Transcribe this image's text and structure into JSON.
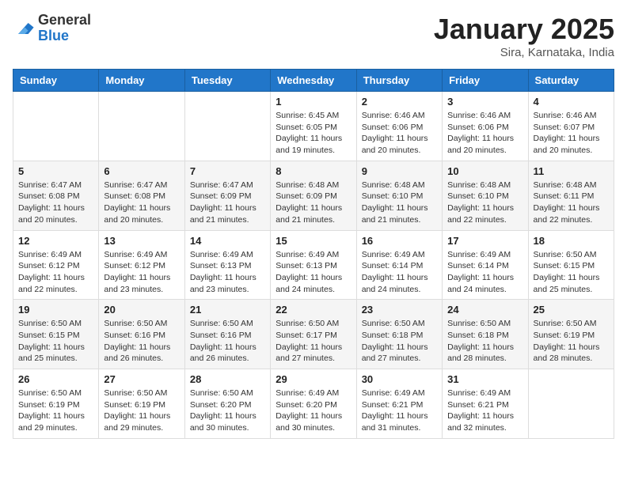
{
  "header": {
    "logo_general": "General",
    "logo_blue": "Blue",
    "title": "January 2025",
    "subtitle": "Sira, Karnataka, India"
  },
  "days_of_week": [
    "Sunday",
    "Monday",
    "Tuesday",
    "Wednesday",
    "Thursday",
    "Friday",
    "Saturday"
  ],
  "weeks": [
    [
      {
        "day": "",
        "info": ""
      },
      {
        "day": "",
        "info": ""
      },
      {
        "day": "",
        "info": ""
      },
      {
        "day": "1",
        "info": "Sunrise: 6:45 AM\nSunset: 6:05 PM\nDaylight: 11 hours and 19 minutes."
      },
      {
        "day": "2",
        "info": "Sunrise: 6:46 AM\nSunset: 6:06 PM\nDaylight: 11 hours and 20 minutes."
      },
      {
        "day": "3",
        "info": "Sunrise: 6:46 AM\nSunset: 6:06 PM\nDaylight: 11 hours and 20 minutes."
      },
      {
        "day": "4",
        "info": "Sunrise: 6:46 AM\nSunset: 6:07 PM\nDaylight: 11 hours and 20 minutes."
      }
    ],
    [
      {
        "day": "5",
        "info": "Sunrise: 6:47 AM\nSunset: 6:08 PM\nDaylight: 11 hours and 20 minutes."
      },
      {
        "day": "6",
        "info": "Sunrise: 6:47 AM\nSunset: 6:08 PM\nDaylight: 11 hours and 20 minutes."
      },
      {
        "day": "7",
        "info": "Sunrise: 6:47 AM\nSunset: 6:09 PM\nDaylight: 11 hours and 21 minutes."
      },
      {
        "day": "8",
        "info": "Sunrise: 6:48 AM\nSunset: 6:09 PM\nDaylight: 11 hours and 21 minutes."
      },
      {
        "day": "9",
        "info": "Sunrise: 6:48 AM\nSunset: 6:10 PM\nDaylight: 11 hours and 21 minutes."
      },
      {
        "day": "10",
        "info": "Sunrise: 6:48 AM\nSunset: 6:10 PM\nDaylight: 11 hours and 22 minutes."
      },
      {
        "day": "11",
        "info": "Sunrise: 6:48 AM\nSunset: 6:11 PM\nDaylight: 11 hours and 22 minutes."
      }
    ],
    [
      {
        "day": "12",
        "info": "Sunrise: 6:49 AM\nSunset: 6:12 PM\nDaylight: 11 hours and 22 minutes."
      },
      {
        "day": "13",
        "info": "Sunrise: 6:49 AM\nSunset: 6:12 PM\nDaylight: 11 hours and 23 minutes."
      },
      {
        "day": "14",
        "info": "Sunrise: 6:49 AM\nSunset: 6:13 PM\nDaylight: 11 hours and 23 minutes."
      },
      {
        "day": "15",
        "info": "Sunrise: 6:49 AM\nSunset: 6:13 PM\nDaylight: 11 hours and 24 minutes."
      },
      {
        "day": "16",
        "info": "Sunrise: 6:49 AM\nSunset: 6:14 PM\nDaylight: 11 hours and 24 minutes."
      },
      {
        "day": "17",
        "info": "Sunrise: 6:49 AM\nSunset: 6:14 PM\nDaylight: 11 hours and 24 minutes."
      },
      {
        "day": "18",
        "info": "Sunrise: 6:50 AM\nSunset: 6:15 PM\nDaylight: 11 hours and 25 minutes."
      }
    ],
    [
      {
        "day": "19",
        "info": "Sunrise: 6:50 AM\nSunset: 6:15 PM\nDaylight: 11 hours and 25 minutes."
      },
      {
        "day": "20",
        "info": "Sunrise: 6:50 AM\nSunset: 6:16 PM\nDaylight: 11 hours and 26 minutes."
      },
      {
        "day": "21",
        "info": "Sunrise: 6:50 AM\nSunset: 6:16 PM\nDaylight: 11 hours and 26 minutes."
      },
      {
        "day": "22",
        "info": "Sunrise: 6:50 AM\nSunset: 6:17 PM\nDaylight: 11 hours and 27 minutes."
      },
      {
        "day": "23",
        "info": "Sunrise: 6:50 AM\nSunset: 6:18 PM\nDaylight: 11 hours and 27 minutes."
      },
      {
        "day": "24",
        "info": "Sunrise: 6:50 AM\nSunset: 6:18 PM\nDaylight: 11 hours and 28 minutes."
      },
      {
        "day": "25",
        "info": "Sunrise: 6:50 AM\nSunset: 6:19 PM\nDaylight: 11 hours and 28 minutes."
      }
    ],
    [
      {
        "day": "26",
        "info": "Sunrise: 6:50 AM\nSunset: 6:19 PM\nDaylight: 11 hours and 29 minutes."
      },
      {
        "day": "27",
        "info": "Sunrise: 6:50 AM\nSunset: 6:19 PM\nDaylight: 11 hours and 29 minutes."
      },
      {
        "day": "28",
        "info": "Sunrise: 6:50 AM\nSunset: 6:20 PM\nDaylight: 11 hours and 30 minutes."
      },
      {
        "day": "29",
        "info": "Sunrise: 6:49 AM\nSunset: 6:20 PM\nDaylight: 11 hours and 30 minutes."
      },
      {
        "day": "30",
        "info": "Sunrise: 6:49 AM\nSunset: 6:21 PM\nDaylight: 11 hours and 31 minutes."
      },
      {
        "day": "31",
        "info": "Sunrise: 6:49 AM\nSunset: 6:21 PM\nDaylight: 11 hours and 32 minutes."
      },
      {
        "day": "",
        "info": ""
      }
    ]
  ]
}
